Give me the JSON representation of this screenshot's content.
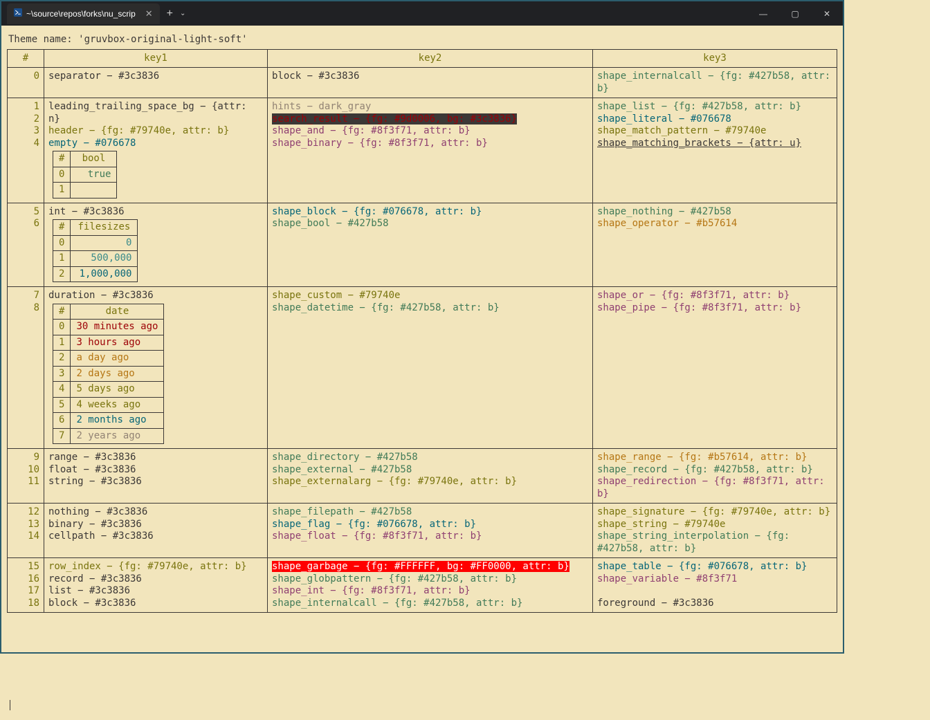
{
  "window": {
    "tab_title": "~\\source\\repos\\forks\\nu_scrip",
    "minimize": "—",
    "maximize": "▢",
    "close": "✕",
    "newtab": "+",
    "chevron": "⌄"
  },
  "themeline": "Theme name: 'gruvbox-original-light-soft'",
  "headers": {
    "num": "#",
    "k1": "key1",
    "k2": "key2",
    "k3": "key3"
  },
  "rows": [
    {
      "n": "0",
      "k1": [
        {
          "t": "separator − #3c3836",
          "c": "c-dark"
        }
      ],
      "k2": [
        {
          "t": "block − #3c3836",
          "c": "c-dark"
        }
      ],
      "k3": [
        {
          "t": "shape_internalcall − {fg: #427b58, attr: b}",
          "c": "c-green"
        }
      ]
    },
    {
      "n": "1",
      "k1": [
        {
          "t": "leading_trailing_space_bg − {attr: n}",
          "c": "c-dark"
        }
      ],
      "k2": [
        {
          "t": "hints − dark_gray",
          "c": "c-grey"
        }
      ],
      "k3": [
        {
          "t": "shape_list − {fg: #427b58, attr: b}",
          "c": "c-green"
        }
      ]
    },
    {
      "n": "2",
      "k1": [
        {
          "t": "header − {fg: #79740e, attr: b}",
          "c": "c-olive"
        }
      ],
      "k2": [
        {
          "t": "search_result − {fg: #9d0006, bg: #3c3836}",
          "c": "c-red bg-dark"
        }
      ],
      "k3": [
        {
          "t": "shape_literal − #076678",
          "c": "c-teal"
        }
      ]
    },
    {
      "n": "3",
      "k1": [
        {
          "t": "empty − #076678",
          "c": "c-teal"
        }
      ],
      "k2": [
        {
          "t": "shape_and − {fg: #8f3f71, attr: b}",
          "c": "c-purple"
        }
      ],
      "k3": [
        {
          "t": "shape_match_pattern − #79740e",
          "c": "c-olive"
        }
      ]
    },
    {
      "n": "4",
      "k1_table": "bool",
      "k2": [
        {
          "t": "shape_binary − {fg: #8f3f71, attr: b}",
          "c": "c-purple"
        }
      ],
      "k3": [
        {
          "t": "shape_matching_brackets − {attr: u}",
          "c": "c-dark underline"
        }
      ]
    },
    {
      "n": "5",
      "k1": [
        {
          "t": "int − #3c3836",
          "c": "c-dark"
        }
      ],
      "k2": [
        {
          "t": "shape_block − {fg: #076678, attr: b}",
          "c": "c-teal"
        }
      ],
      "k3": [
        {
          "t": "shape_nothing − #427b58",
          "c": "c-green"
        }
      ]
    },
    {
      "n": "6",
      "k1_table": "filesizes",
      "k2": [
        {
          "t": "shape_bool − #427b58",
          "c": "c-green"
        }
      ],
      "k3": [
        {
          "t": "shape_operator − #b57614",
          "c": "c-yellow"
        }
      ]
    },
    {
      "n": "7",
      "k1": [
        {
          "t": "duration − #3c3836",
          "c": "c-dark"
        }
      ],
      "k2": [
        {
          "t": "shape_custom − #79740e",
          "c": "c-olive"
        }
      ],
      "k3": [
        {
          "t": "shape_or − {fg: #8f3f71, attr: b}",
          "c": "c-purple"
        }
      ]
    },
    {
      "n": "8",
      "k1_table": "date",
      "k2": [
        {
          "t": "shape_datetime − {fg: #427b58, attr: b}",
          "c": "c-green"
        }
      ],
      "k3": [
        {
          "t": "shape_pipe − {fg: #8f3f71, attr: b}",
          "c": "c-purple"
        }
      ]
    },
    {
      "n": "9",
      "k1": [
        {
          "t": "range − #3c3836",
          "c": "c-dark"
        }
      ],
      "k2": [
        {
          "t": "shape_directory − #427b58",
          "c": "c-green"
        }
      ],
      "k3": [
        {
          "t": "shape_range − {fg: #b57614, attr: b}",
          "c": "c-yellow"
        }
      ]
    },
    {
      "n": "10",
      "k1": [
        {
          "t": "float − #3c3836",
          "c": "c-dark"
        }
      ],
      "k2": [
        {
          "t": "shape_external − #427b58",
          "c": "c-green"
        }
      ],
      "k3": [
        {
          "t": "shape_record − {fg: #427b58, attr: b}",
          "c": "c-green"
        }
      ]
    },
    {
      "n": "11",
      "k1": [
        {
          "t": "string − #3c3836",
          "c": "c-dark"
        }
      ],
      "k2": [
        {
          "t": "shape_externalarg − {fg: #79740e, attr: b}",
          "c": "c-olive"
        }
      ],
      "k3": [
        {
          "t": "shape_redirection − {fg: #8f3f71, attr: b}",
          "c": "c-purple"
        }
      ]
    },
    {
      "n": "12",
      "k1": [
        {
          "t": "nothing − #3c3836",
          "c": "c-dark"
        }
      ],
      "k2": [
        {
          "t": "shape_filepath − #427b58",
          "c": "c-green"
        }
      ],
      "k3": [
        {
          "t": "shape_signature − {fg: #79740e, attr: b}",
          "c": "c-olive"
        }
      ]
    },
    {
      "n": "13",
      "k1": [
        {
          "t": "binary − #3c3836",
          "c": "c-dark"
        }
      ],
      "k2": [
        {
          "t": "shape_flag − {fg: #076678, attr: b}",
          "c": "c-teal"
        }
      ],
      "k3": [
        {
          "t": "shape_string − #79740e",
          "c": "c-olive"
        }
      ]
    },
    {
      "n": "14",
      "k1": [
        {
          "t": "cellpath − #3c3836",
          "c": "c-dark"
        }
      ],
      "k2": [
        {
          "t": "shape_float − {fg: #8f3f71, attr: b}",
          "c": "c-purple"
        }
      ],
      "k3": [
        {
          "t": "shape_string_interpolation − {fg: #427b58, attr: b}",
          "c": "c-green"
        }
      ]
    },
    {
      "n": "15",
      "k1": [
        {
          "t": "row_index − {fg: #79740e, attr: b}",
          "c": "c-olive"
        }
      ],
      "k2": [
        {
          "t": "shape_garbage − {fg: #FFFFFF, bg: #FF0000, attr: b}",
          "c": "bg-red"
        }
      ],
      "k3": [
        {
          "t": "shape_table − {fg: #076678, attr: b}",
          "c": "c-teal"
        }
      ]
    },
    {
      "n": "16",
      "k1": [
        {
          "t": "record − #3c3836",
          "c": "c-dark"
        }
      ],
      "k2": [
        {
          "t": "shape_globpattern − {fg: #427b58, attr: b}",
          "c": "c-green"
        }
      ],
      "k3": [
        {
          "t": "shape_variable − #8f3f71",
          "c": "c-purple"
        }
      ]
    },
    {
      "n": "17",
      "k1": [
        {
          "t": "list − #3c3836",
          "c": "c-dark"
        }
      ],
      "k2": [
        {
          "t": "shape_int − {fg: #8f3f71, attr: b}",
          "c": "c-purple"
        }
      ],
      "k3": [
        {
          "t": "",
          "c": ""
        }
      ]
    },
    {
      "n": "18",
      "k1": [
        {
          "t": "block − #3c3836",
          "c": "c-dark"
        }
      ],
      "k2": [
        {
          "t": "shape_internalcall − {fg: #427b58, attr: b}",
          "c": "c-green"
        }
      ],
      "k3": [
        {
          "t": "foreground − #3c3836",
          "c": "c-dark"
        }
      ]
    }
  ],
  "inner_tables": {
    "bool": {
      "header": "bool",
      "rows": [
        {
          "i": "0",
          "v": "true",
          "c": "c-green"
        },
        {
          "i": "1",
          "v": "false",
          "c": "c-white"
        }
      ]
    },
    "filesizes": {
      "header": "filesizes",
      "rows": [
        {
          "i": "0",
          "v": "0",
          "c": "c-teal2"
        },
        {
          "i": "1",
          "v": "500,000",
          "c": "c-teal2"
        },
        {
          "i": "2",
          "v": "1,000,000",
          "c": "c-blue"
        }
      ]
    },
    "date": {
      "header": "date",
      "rows": [
        {
          "i": "0",
          "v": "30 minutes ago",
          "c": "c-red"
        },
        {
          "i": "1",
          "v": "3 hours ago",
          "c": "c-red"
        },
        {
          "i": "2",
          "v": "a day ago",
          "c": "c-yellow"
        },
        {
          "i": "3",
          "v": "2 days ago",
          "c": "c-yellow"
        },
        {
          "i": "4",
          "v": "5 days ago",
          "c": "c-olive"
        },
        {
          "i": "5",
          "v": "4 weeks ago",
          "c": "c-olive"
        },
        {
          "i": "6",
          "v": "2 months ago",
          "c": "c-teal"
        },
        {
          "i": "7",
          "v": "2 years ago",
          "c": "c-grey"
        }
      ]
    }
  }
}
